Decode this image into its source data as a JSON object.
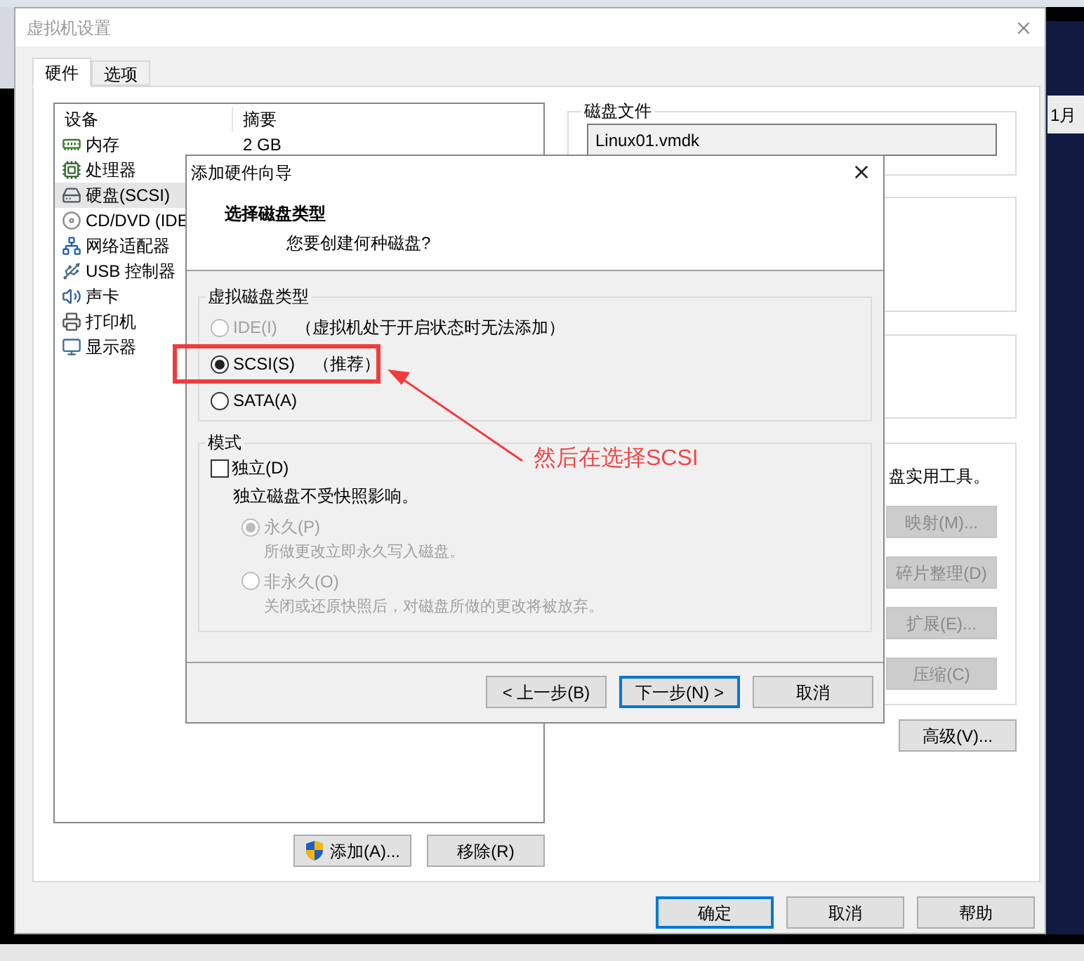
{
  "desktop": {
    "calendar_tab": "1月"
  },
  "settings_dialog": {
    "title": "虚拟机设置",
    "tabs": [
      {
        "label": "硬件",
        "selected": true
      },
      {
        "label": "选项",
        "selected": false
      }
    ],
    "device_list": {
      "columns": [
        "设备",
        "摘要"
      ],
      "rows": [
        {
          "kind": "memory",
          "name": "内存",
          "summary": "2 GB",
          "selected": false
        },
        {
          "kind": "cpu",
          "name": "处理器",
          "selected": false
        },
        {
          "kind": "disk",
          "name": "硬盘(SCSI)",
          "selected": true
        },
        {
          "kind": "cdrom",
          "name": "CD/DVD (IDE",
          "selected": false
        },
        {
          "kind": "network",
          "name": "网络适配器",
          "selected": false
        },
        {
          "kind": "usb",
          "name": "USB 控制器",
          "selected": false
        },
        {
          "kind": "sound",
          "name": "声卡",
          "selected": false
        },
        {
          "kind": "printer",
          "name": "打印机",
          "selected": false
        },
        {
          "kind": "display",
          "name": "显示器",
          "selected": false
        }
      ]
    },
    "list_buttons": [
      {
        "kind": "shield",
        "label": "添加(A)..."
      },
      {
        "kind": "plain",
        "label": "移除(R)"
      }
    ],
    "disk_file": {
      "legend": "磁盘文件",
      "value": "Linux01.vmdk"
    },
    "utilities": {
      "text": "盘实用工具。",
      "buttons": [
        {
          "label": "映射(M)...",
          "disabled": true
        },
        {
          "label": "碎片整理(D)",
          "disabled": true
        },
        {
          "label": "扩展(E)...",
          "disabled": true
        },
        {
          "label": "压缩(C)",
          "disabled": true
        }
      ]
    },
    "advanced_button": {
      "label": "高级(V)...",
      "disabled": false
    },
    "footer_buttons": [
      {
        "label": "确定",
        "default": true
      },
      {
        "label": "取消",
        "default": false
      },
      {
        "label": "帮助",
        "default": false
      }
    ]
  },
  "wizard": {
    "title": "添加硬件向导",
    "heading": "选择磁盘类型",
    "subheading": "您要创建何种磁盘?",
    "disk_type": {
      "legend": "虚拟磁盘类型",
      "options": [
        {
          "label": "IDE(I)",
          "note": "（虚拟机处于开启状态时无法添加）",
          "selected": false,
          "disabled": true
        },
        {
          "label": "SCSI(S)",
          "note": "（推荐）",
          "selected": true,
          "disabled": false
        },
        {
          "label": "SATA(A)",
          "selected": false,
          "disabled": false
        }
      ]
    },
    "mode": {
      "legend": "模式",
      "independent": {
        "label": "独立(D)",
        "checked": false
      },
      "description": "独立磁盘不受快照影响。",
      "options": [
        {
          "label": "永久(P)",
          "description": "所做更改立即永久写入磁盘。",
          "selected": true,
          "disabled": true
        },
        {
          "label": "非永久(O)",
          "description": "关闭或还原快照后，对磁盘所做的更改将被放弃。",
          "selected": false,
          "disabled": true
        }
      ]
    },
    "buttons": [
      {
        "label": "< 上一步(B)",
        "default": false
      },
      {
        "label": "下一步(N) >",
        "default": true
      },
      {
        "label": "取消",
        "default": false
      }
    ]
  },
  "annotation": {
    "callout": "然后在选择SCSI"
  }
}
